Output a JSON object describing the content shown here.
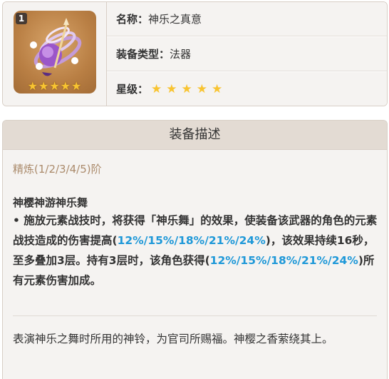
{
  "item": {
    "refine_badge": "1",
    "stars_glyph": "★★★★★",
    "rarity_stars": 5,
    "name_label": "名称：",
    "name_value": "神乐之真意",
    "type_label": "装备类型：",
    "type_value": "法器",
    "rarity_label": "星级：",
    "art_icon": "catalyst-bell-icon"
  },
  "description": {
    "header": "装备描述",
    "refine_levels": "精炼(1/2/3/4/5)阶",
    "passive_name": "神樱神游神乐舞",
    "passive_text_1": " • 施放元素战技时，将获得「神乐舞」的效果，使装备该武器的角色的元素战技造成的伤害提高(",
    "passive_hl_1": "12%/15%/18%/21%/24%",
    "passive_text_2": ")，该效果持续16秒，至多叠加3层。持有3层时，该角色获得(",
    "passive_hl_2": "12%/15%/18%/21%/24%",
    "passive_text_3": ")所有元素伤害加成。",
    "lore": "表演神乐之舞时所用的神铃，为官司所赐福。神樱之香萦绕其上。"
  },
  "colors": {
    "highlight": "#1e98d8",
    "star": "#f8c431",
    "refine_text": "#ab8b6c"
  }
}
